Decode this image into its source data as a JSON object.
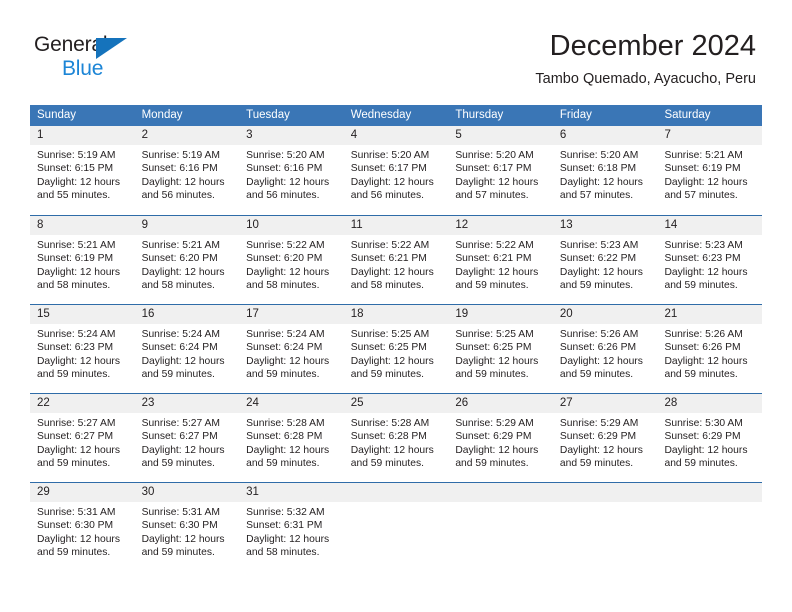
{
  "brand": {
    "name_part1": "General",
    "name_part2": "Blue",
    "triangle_color": "#1573bc",
    "blue_text_color": "#1c85d6"
  },
  "header": {
    "title": "December 2024",
    "subtitle": "Tambo Quemado, Ayacucho, Peru"
  },
  "theme": {
    "header_blue": "#3a76b6",
    "row_divider_blue": "#2f6ca8",
    "day_band_gray": "#f0f0f0",
    "text_color": "#231f20"
  },
  "weekdays": [
    "Sunday",
    "Monday",
    "Tuesday",
    "Wednesday",
    "Thursday",
    "Friday",
    "Saturday"
  ],
  "weeks": [
    {
      "days": [
        {
          "number": "1",
          "sunrise": "Sunrise: 5:19 AM",
          "sunset": "Sunset: 6:15 PM",
          "daylight_line1": "Daylight: 12 hours",
          "daylight_line2": "and 55 minutes."
        },
        {
          "number": "2",
          "sunrise": "Sunrise: 5:19 AM",
          "sunset": "Sunset: 6:16 PM",
          "daylight_line1": "Daylight: 12 hours",
          "daylight_line2": "and 56 minutes."
        },
        {
          "number": "3",
          "sunrise": "Sunrise: 5:20 AM",
          "sunset": "Sunset: 6:16 PM",
          "daylight_line1": "Daylight: 12 hours",
          "daylight_line2": "and 56 minutes."
        },
        {
          "number": "4",
          "sunrise": "Sunrise: 5:20 AM",
          "sunset": "Sunset: 6:17 PM",
          "daylight_line1": "Daylight: 12 hours",
          "daylight_line2": "and 56 minutes."
        },
        {
          "number": "5",
          "sunrise": "Sunrise: 5:20 AM",
          "sunset": "Sunset: 6:17 PM",
          "daylight_line1": "Daylight: 12 hours",
          "daylight_line2": "and 57 minutes."
        },
        {
          "number": "6",
          "sunrise": "Sunrise: 5:20 AM",
          "sunset": "Sunset: 6:18 PM",
          "daylight_line1": "Daylight: 12 hours",
          "daylight_line2": "and 57 minutes."
        },
        {
          "number": "7",
          "sunrise": "Sunrise: 5:21 AM",
          "sunset": "Sunset: 6:19 PM",
          "daylight_line1": "Daylight: 12 hours",
          "daylight_line2": "and 57 minutes."
        }
      ]
    },
    {
      "days": [
        {
          "number": "8",
          "sunrise": "Sunrise: 5:21 AM",
          "sunset": "Sunset: 6:19 PM",
          "daylight_line1": "Daylight: 12 hours",
          "daylight_line2": "and 58 minutes."
        },
        {
          "number": "9",
          "sunrise": "Sunrise: 5:21 AM",
          "sunset": "Sunset: 6:20 PM",
          "daylight_line1": "Daylight: 12 hours",
          "daylight_line2": "and 58 minutes."
        },
        {
          "number": "10",
          "sunrise": "Sunrise: 5:22 AM",
          "sunset": "Sunset: 6:20 PM",
          "daylight_line1": "Daylight: 12 hours",
          "daylight_line2": "and 58 minutes."
        },
        {
          "number": "11",
          "sunrise": "Sunrise: 5:22 AM",
          "sunset": "Sunset: 6:21 PM",
          "daylight_line1": "Daylight: 12 hours",
          "daylight_line2": "and 58 minutes."
        },
        {
          "number": "12",
          "sunrise": "Sunrise: 5:22 AM",
          "sunset": "Sunset: 6:21 PM",
          "daylight_line1": "Daylight: 12 hours",
          "daylight_line2": "and 59 minutes."
        },
        {
          "number": "13",
          "sunrise": "Sunrise: 5:23 AM",
          "sunset": "Sunset: 6:22 PM",
          "daylight_line1": "Daylight: 12 hours",
          "daylight_line2": "and 59 minutes."
        },
        {
          "number": "14",
          "sunrise": "Sunrise: 5:23 AM",
          "sunset": "Sunset: 6:23 PM",
          "daylight_line1": "Daylight: 12 hours",
          "daylight_line2": "and 59 minutes."
        }
      ]
    },
    {
      "days": [
        {
          "number": "15",
          "sunrise": "Sunrise: 5:24 AM",
          "sunset": "Sunset: 6:23 PM",
          "daylight_line1": "Daylight: 12 hours",
          "daylight_line2": "and 59 minutes."
        },
        {
          "number": "16",
          "sunrise": "Sunrise: 5:24 AM",
          "sunset": "Sunset: 6:24 PM",
          "daylight_line1": "Daylight: 12 hours",
          "daylight_line2": "and 59 minutes."
        },
        {
          "number": "17",
          "sunrise": "Sunrise: 5:24 AM",
          "sunset": "Sunset: 6:24 PM",
          "daylight_line1": "Daylight: 12 hours",
          "daylight_line2": "and 59 minutes."
        },
        {
          "number": "18",
          "sunrise": "Sunrise: 5:25 AM",
          "sunset": "Sunset: 6:25 PM",
          "daylight_line1": "Daylight: 12 hours",
          "daylight_line2": "and 59 minutes."
        },
        {
          "number": "19",
          "sunrise": "Sunrise: 5:25 AM",
          "sunset": "Sunset: 6:25 PM",
          "daylight_line1": "Daylight: 12 hours",
          "daylight_line2": "and 59 minutes."
        },
        {
          "number": "20",
          "sunrise": "Sunrise: 5:26 AM",
          "sunset": "Sunset: 6:26 PM",
          "daylight_line1": "Daylight: 12 hours",
          "daylight_line2": "and 59 minutes."
        },
        {
          "number": "21",
          "sunrise": "Sunrise: 5:26 AM",
          "sunset": "Sunset: 6:26 PM",
          "daylight_line1": "Daylight: 12 hours",
          "daylight_line2": "and 59 minutes."
        }
      ]
    },
    {
      "days": [
        {
          "number": "22",
          "sunrise": "Sunrise: 5:27 AM",
          "sunset": "Sunset: 6:27 PM",
          "daylight_line1": "Daylight: 12 hours",
          "daylight_line2": "and 59 minutes."
        },
        {
          "number": "23",
          "sunrise": "Sunrise: 5:27 AM",
          "sunset": "Sunset: 6:27 PM",
          "daylight_line1": "Daylight: 12 hours",
          "daylight_line2": "and 59 minutes."
        },
        {
          "number": "24",
          "sunrise": "Sunrise: 5:28 AM",
          "sunset": "Sunset: 6:28 PM",
          "daylight_line1": "Daylight: 12 hours",
          "daylight_line2": "and 59 minutes."
        },
        {
          "number": "25",
          "sunrise": "Sunrise: 5:28 AM",
          "sunset": "Sunset: 6:28 PM",
          "daylight_line1": "Daylight: 12 hours",
          "daylight_line2": "and 59 minutes."
        },
        {
          "number": "26",
          "sunrise": "Sunrise: 5:29 AM",
          "sunset": "Sunset: 6:29 PM",
          "daylight_line1": "Daylight: 12 hours",
          "daylight_line2": "and 59 minutes."
        },
        {
          "number": "27",
          "sunrise": "Sunrise: 5:29 AM",
          "sunset": "Sunset: 6:29 PM",
          "daylight_line1": "Daylight: 12 hours",
          "daylight_line2": "and 59 minutes."
        },
        {
          "number": "28",
          "sunrise": "Sunrise: 5:30 AM",
          "sunset": "Sunset: 6:29 PM",
          "daylight_line1": "Daylight: 12 hours",
          "daylight_line2": "and 59 minutes."
        }
      ]
    },
    {
      "days": [
        {
          "number": "29",
          "sunrise": "Sunrise: 5:31 AM",
          "sunset": "Sunset: 6:30 PM",
          "daylight_line1": "Daylight: 12 hours",
          "daylight_line2": "and 59 minutes."
        },
        {
          "number": "30",
          "sunrise": "Sunrise: 5:31 AM",
          "sunset": "Sunset: 6:30 PM",
          "daylight_line1": "Daylight: 12 hours",
          "daylight_line2": "and 59 minutes."
        },
        {
          "number": "31",
          "sunrise": "Sunrise: 5:32 AM",
          "sunset": "Sunset: 6:31 PM",
          "daylight_line1": "Daylight: 12 hours",
          "daylight_line2": "and 58 minutes."
        },
        {
          "number": "",
          "sunrise": "",
          "sunset": "",
          "daylight_line1": "",
          "daylight_line2": ""
        },
        {
          "number": "",
          "sunrise": "",
          "sunset": "",
          "daylight_line1": "",
          "daylight_line2": ""
        },
        {
          "number": "",
          "sunrise": "",
          "sunset": "",
          "daylight_line1": "",
          "daylight_line2": ""
        },
        {
          "number": "",
          "sunrise": "",
          "sunset": "",
          "daylight_line1": "",
          "daylight_line2": ""
        }
      ]
    }
  ]
}
